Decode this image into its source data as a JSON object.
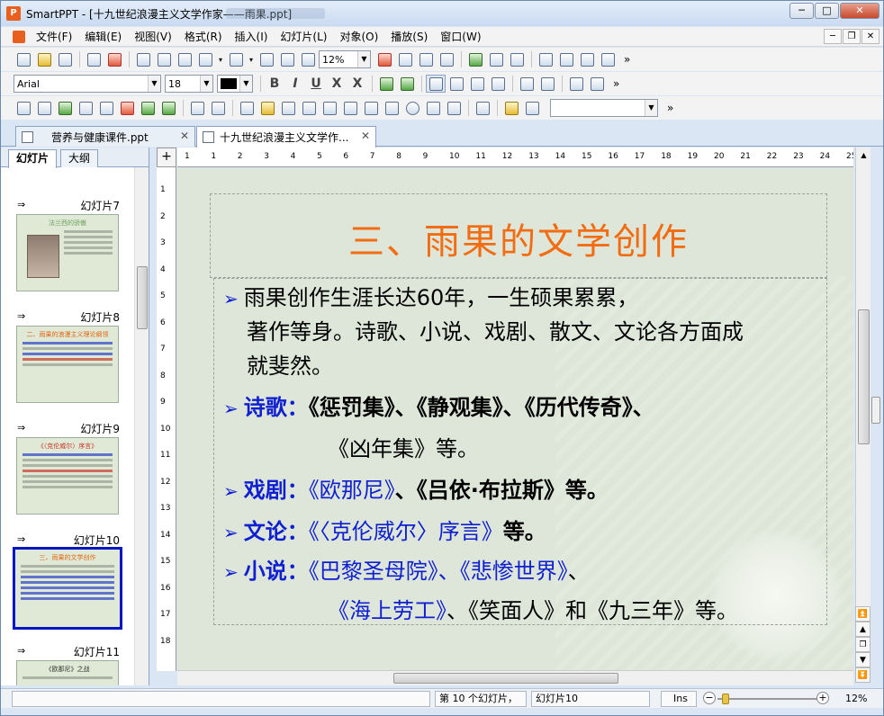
{
  "window": {
    "title": "SmartPPT - [十九世纪浪漫主义文学作家——雨果.ppt]",
    "buttons": [
      "─",
      "□",
      "✕"
    ]
  },
  "menu": {
    "items": [
      "文件(F)",
      "编辑(E)",
      "视图(V)",
      "格式(R)",
      "插入(I)",
      "幻灯片(L)",
      "对象(O)",
      "播放(S)",
      "窗口(W)"
    ],
    "mdi_buttons": [
      "─",
      "❐",
      "✕"
    ]
  },
  "toolbar": {
    "zoom_value": "12%",
    "font_name": "Arial",
    "font_size": "18",
    "format_buttons": [
      "B",
      "I",
      "U",
      "X",
      "X"
    ],
    "more": "»"
  },
  "doc_tabs": [
    {
      "label": "营养与健康课件.ppt",
      "close": "✕",
      "active": false
    },
    {
      "label": "十九世纪浪漫主义文学作...",
      "close": "✕",
      "active": true
    }
  ],
  "panel": {
    "tabs": [
      "幻灯片",
      "大纲"
    ],
    "thumbs": [
      {
        "label": "幻灯片7",
        "title": "法兰西的骄傲"
      },
      {
        "label": "幻灯片8",
        "title": "二、雨果的浪漫主义理论纲领"
      },
      {
        "label": "幻灯片9",
        "title": "《〈克伦威尔〉序言》"
      },
      {
        "label": "幻灯片10",
        "title": "三、雨果的文学创作"
      },
      {
        "label": "幻灯片11",
        "title": "《欧那尼》之战"
      }
    ]
  },
  "ruler": {
    "h_numbers": [
      "1",
      "1",
      "2",
      "3",
      "4",
      "5",
      "6",
      "7",
      "8",
      "9",
      "10",
      "11",
      "12",
      "13",
      "14",
      "15",
      "16",
      "17",
      "18",
      "19",
      "20",
      "21",
      "22",
      "23",
      "24",
      "25"
    ],
    "v_numbers": [
      "1",
      "2",
      "3",
      "4",
      "5",
      "6",
      "7",
      "8",
      "9",
      "10",
      "11",
      "12",
      "13",
      "14",
      "15",
      "16",
      "17",
      "18"
    ],
    "corner": "+"
  },
  "slide": {
    "title": "三、雨果的文学创作",
    "bullet": "➢",
    "p1_line1": "雨果创作生涯长达60年，一生硕果累累，",
    "p1_line2": "著作等身。诗歌、小说、戏剧、散文、文论各方面成",
    "p1_line3": "就斐然。",
    "poetry_label": "诗歌：",
    "poetry_works": "《惩罚集》、《静观集》、《历代传奇》、",
    "poetry_works2": "《凶年集》等。",
    "drama_label": "戏剧：",
    "drama_work1": "《欧那尼》",
    "drama_rest": "、《吕依·布拉斯》等。",
    "theory_label": "文论：",
    "theory_work": "《〈克伦威尔〉序言》",
    "theory_rest": "等。",
    "novel_label": "小说：",
    "novel_works": "《巴黎圣母院》、《悲惨世界》",
    "novel_sep": "、",
    "novel_work3": "《海上劳工》",
    "novel_rest": "、《笑面人》和《九三年》等。"
  },
  "status": {
    "slide_count": "第 10 个幻灯片，",
    "slide_name": "幻灯片10",
    "mode": "Ins",
    "zoom": "12%",
    "minus": "−",
    "plus": "+"
  },
  "colors": {
    "title_orange": "#f26c12",
    "accent_blue": "#1020d0",
    "selection": "#0015c4"
  }
}
